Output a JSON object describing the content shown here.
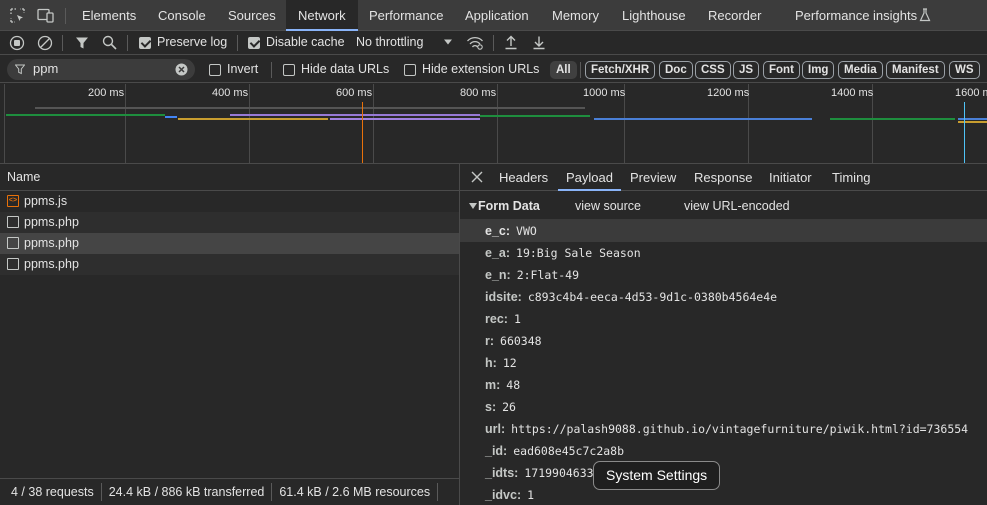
{
  "tabs": [
    "Elements",
    "Console",
    "Sources",
    "Network",
    "Performance",
    "Application",
    "Memory",
    "Lighthouse",
    "Recorder",
    "Performance insights"
  ],
  "toolbar": {
    "preserve_log": "Preserve log",
    "disable_cache": "Disable cache",
    "throttling": "No throttling"
  },
  "filter": {
    "value": "ppm",
    "invert": "Invert",
    "hide_data_urls": "Hide data URLs",
    "hide_extension_urls": "Hide extension URLs",
    "types": [
      "All",
      "Fetch/XHR",
      "Doc",
      "CSS",
      "JS",
      "Font",
      "Img",
      "Media",
      "Manifest",
      "WS"
    ],
    "selected_type": "All"
  },
  "overview": {
    "ticks": [
      "200 ms",
      "400 ms",
      "600 ms",
      "800 ms",
      "1000 ms",
      "1200 ms",
      "1400 ms",
      "1600 ms"
    ]
  },
  "list": {
    "header": "Name",
    "rows": [
      {
        "name": "ppms.js",
        "type": "js"
      },
      {
        "name": "ppms.php",
        "type": "doc"
      },
      {
        "name": "ppms.php",
        "type": "doc",
        "selected": true
      },
      {
        "name": "ppms.php",
        "type": "doc"
      }
    ]
  },
  "status": {
    "requests": "4 / 38 requests",
    "transferred": "24.4 kB / 886 kB transferred",
    "resources": "61.4 kB / 2.6 MB resources"
  },
  "detail": {
    "tabs": [
      "Headers",
      "Payload",
      "Preview",
      "Response",
      "Initiator",
      "Timing"
    ],
    "active_tab": "Payload",
    "section_title": "Form Data",
    "view_source": "view source",
    "view_url_encoded": "view URL-encoded",
    "fields": [
      {
        "key": "e_c:",
        "value": "VWO"
      },
      {
        "key": "e_a:",
        "value": "19:Big Sale Season"
      },
      {
        "key": "e_n:",
        "value": "2:Flat-49"
      },
      {
        "key": "idsite:",
        "value": "c893c4b4-eeca-4d53-9d1c-0380b4564e4e"
      },
      {
        "key": "rec:",
        "value": "1"
      },
      {
        "key": "r:",
        "value": "660348"
      },
      {
        "key": "h:",
        "value": "12"
      },
      {
        "key": "m:",
        "value": "48"
      },
      {
        "key": "s:",
        "value": "26"
      },
      {
        "key": "url:",
        "value": "https://palash9088.github.io/vintagefurniture/piwik.html?id=736554"
      },
      {
        "key": "_id:",
        "value": "ead608e45c7c2a8b"
      },
      {
        "key": "_idts:",
        "value": "1719904633"
      },
      {
        "key": "_idvc:",
        "value": "1"
      }
    ]
  },
  "tooltip": "System Settings",
  "colors": {
    "accent": "#8ab4f8",
    "background": "#282828",
    "tabbar": "#3c3c3c"
  }
}
